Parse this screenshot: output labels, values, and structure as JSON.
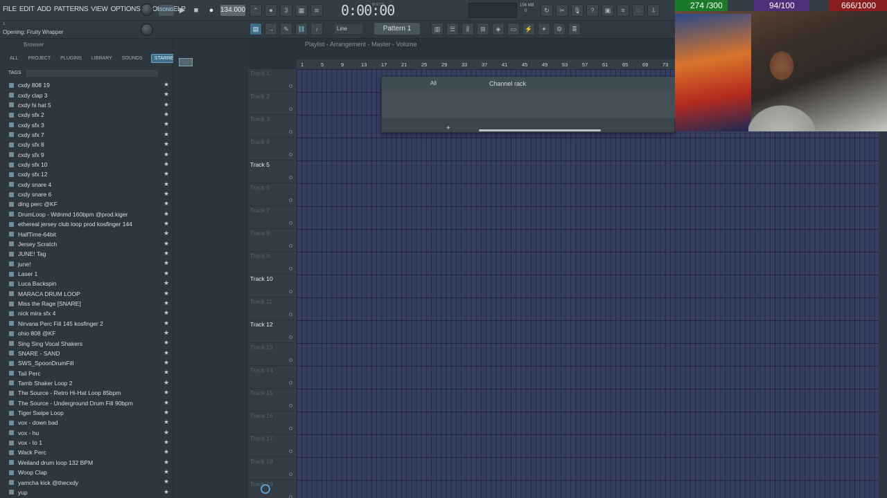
{
  "menu": [
    "FILE",
    "EDIT",
    "ADD",
    "PATTERNS",
    "VIEW",
    "OPTIONS",
    "TOOLS",
    "HELP"
  ],
  "transport": {
    "song_mode": "SONG",
    "tempo": "134.000",
    "time": "0:00:00",
    "time_label": "M:S:CS"
  },
  "system": {
    "memory": "156 MB",
    "cpu": "0"
  },
  "hint": {
    "top": "1",
    "text": "Opening: Fruity Wrapper"
  },
  "snap": {
    "mode": "Line"
  },
  "pattern": {
    "label": "Pattern 1"
  },
  "browser": {
    "title": "Browser",
    "tabs": [
      "ALL",
      "PROJECT",
      "PLUGINS",
      "LIBRARY",
      "SOUNDS",
      "STARRED"
    ],
    "tags_label": "TAGS",
    "files": [
      "cxdy 808 19",
      "cxdy clap 3",
      "cxdy hi hat 5",
      "cxdy sfx 2",
      "cxdy sfx 3",
      "cxdy sfx 7",
      "cxdy sfx 8",
      "cxdy sfx 9",
      "cxdy sfx 10",
      "cxdy sfx 12",
      "cxdy snare 4",
      "cxdy snare 6",
      "ding perc @KF",
      "DrumLoop - Wdnmd 160bpm @prod.kiger",
      "ethereal jersey club loop prod kosfinger 144",
      "HalfTime-64bit",
      "Jersey Scratch",
      "JUNE! Tag",
      "june!",
      "Laser 1",
      "Luca Backspin",
      "MARACA DRUM LOOP",
      "Miss the Rage [SNARE]",
      "nick mira sfx 4",
      "Nirvana Perc Fill 145 kosfinger 2",
      "ohio 808 @KF",
      "Sing Sing Vocal Shakers",
      "SNARE - SAND",
      "SWS_SpoonDrumFill",
      "Tail Perc",
      "Tamb Shaker Loop 2",
      "The Source - Retro Hi-Hat Loop 85bpm",
      "The Source - Underground Drum Fill 90bpm",
      "Tiger Swipe Loop",
      "vox - down bad",
      "vox - hu",
      "vox - to 1",
      "Wack Perc",
      "Weiland drum loop 132 BPM",
      "Woop Clap",
      "yamcha kick @thecxdy",
      "yup"
    ]
  },
  "playlist": {
    "title": "Playlist - Arrangement - Master - Volume",
    "ruler": [
      "1",
      "5",
      "9",
      "13",
      "17",
      "21",
      "25",
      "29",
      "33",
      "37",
      "41",
      "45",
      "49",
      "53",
      "57",
      "61",
      "65",
      "69",
      "73"
    ],
    "tracks": [
      {
        "name": "Track 1",
        "active": false
      },
      {
        "name": "Track 2",
        "active": false
      },
      {
        "name": "Track 3",
        "active": false
      },
      {
        "name": "Track 4",
        "active": false
      },
      {
        "name": "Track 5",
        "active": true
      },
      {
        "name": "Track 6",
        "active": false
      },
      {
        "name": "Track 7",
        "active": false
      },
      {
        "name": "Track 8",
        "active": false
      },
      {
        "name": "Track 9",
        "active": false
      },
      {
        "name": "Track 10",
        "active": true
      },
      {
        "name": "Track 11",
        "active": false
      },
      {
        "name": "Track 12",
        "active": true
      },
      {
        "name": "Track 13",
        "active": false
      },
      {
        "name": "Track 14",
        "active": false
      },
      {
        "name": "Track 15",
        "active": false
      },
      {
        "name": "Track 16",
        "active": false
      },
      {
        "name": "Track 17",
        "active": false
      },
      {
        "name": "Track 18",
        "active": false
      },
      {
        "name": "Track 19",
        "active": false
      }
    ]
  },
  "channel_rack": {
    "title": "Channel rack",
    "filter": "All"
  },
  "stream_overlay": {
    "goal_1": "274 /300",
    "goal_2": "94/100",
    "goal_3": "666/1000"
  }
}
